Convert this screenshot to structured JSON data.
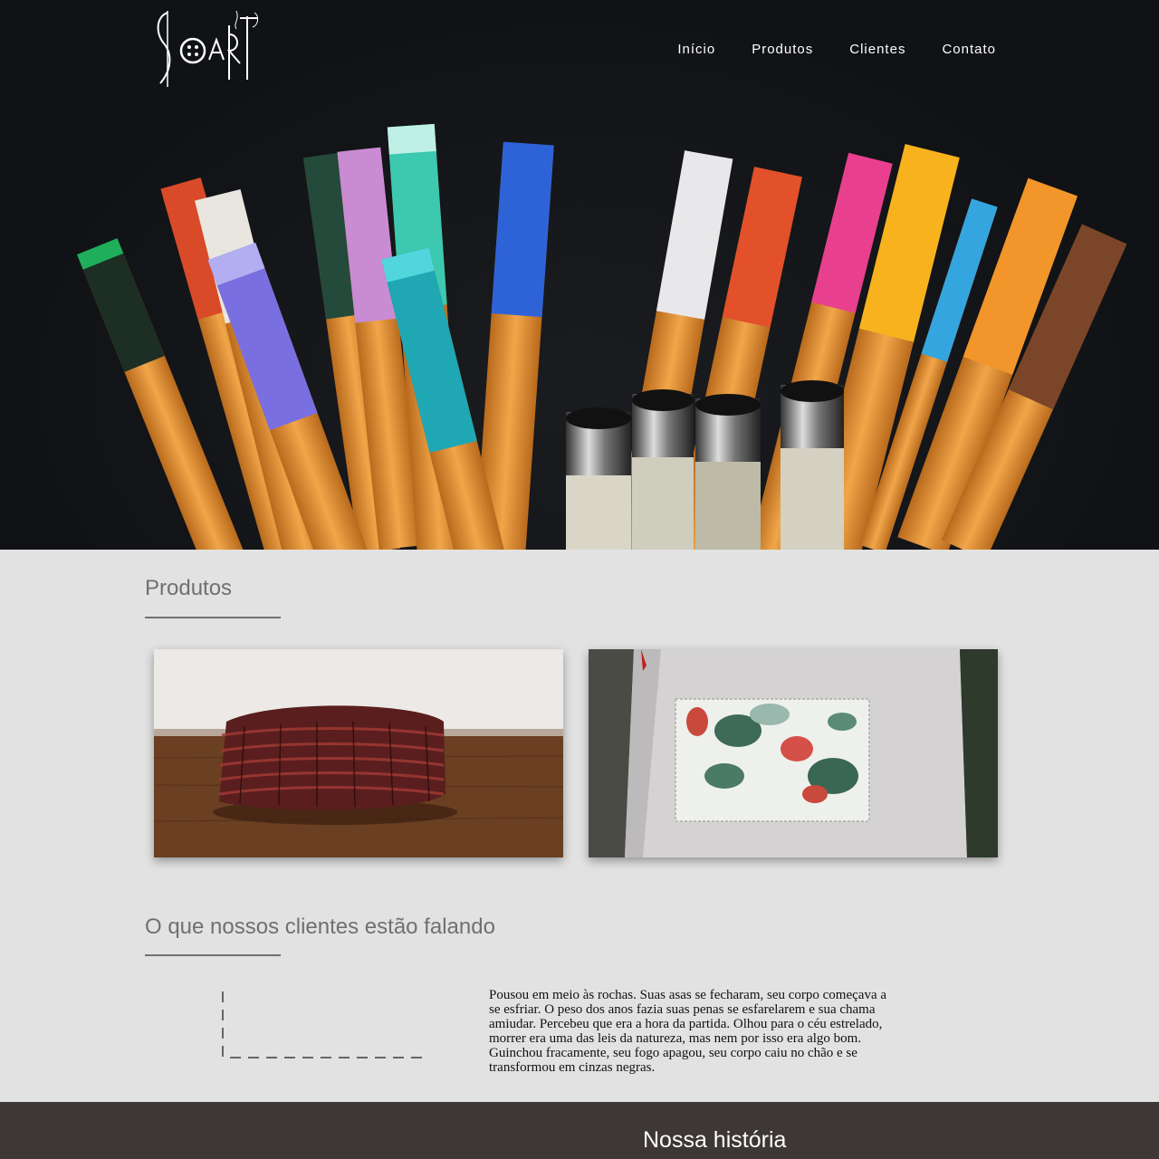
{
  "header": {
    "logo_alt": "SoArt",
    "nav": [
      {
        "label": "Início"
      },
      {
        "label": "Produtos"
      },
      {
        "label": "Clientes"
      },
      {
        "label": "Contato"
      }
    ]
  },
  "products": {
    "title": "Produtos",
    "items": [
      {
        "name": "woven-basket-photo"
      },
      {
        "name": "floral-pocket-apron-photo"
      }
    ]
  },
  "testimonials": {
    "title": "O que nossos clientes estão falando",
    "quote": "Pousou em meio às rochas. Suas asas se fecharam, seu corpo começava a se esfriar. O peso dos anos fazia suas penas se esfarelarem e sua chama amiudar. Percebeu que era a hora da partida. Olhou para o céu estrelado, morrer era uma das leis da natureza, mas nem por isso era algo bom. Guinchou fracamente, seu fogo apagou, seu corpo caiu no chão e se transformou em cinzas negras."
  },
  "footer": {
    "title": "Nossa história"
  },
  "colors": {
    "hero_bg": "#111316",
    "section_bg": "#e2e2e2",
    "heading": "#707070",
    "footer_bg": "#3d3836"
  }
}
